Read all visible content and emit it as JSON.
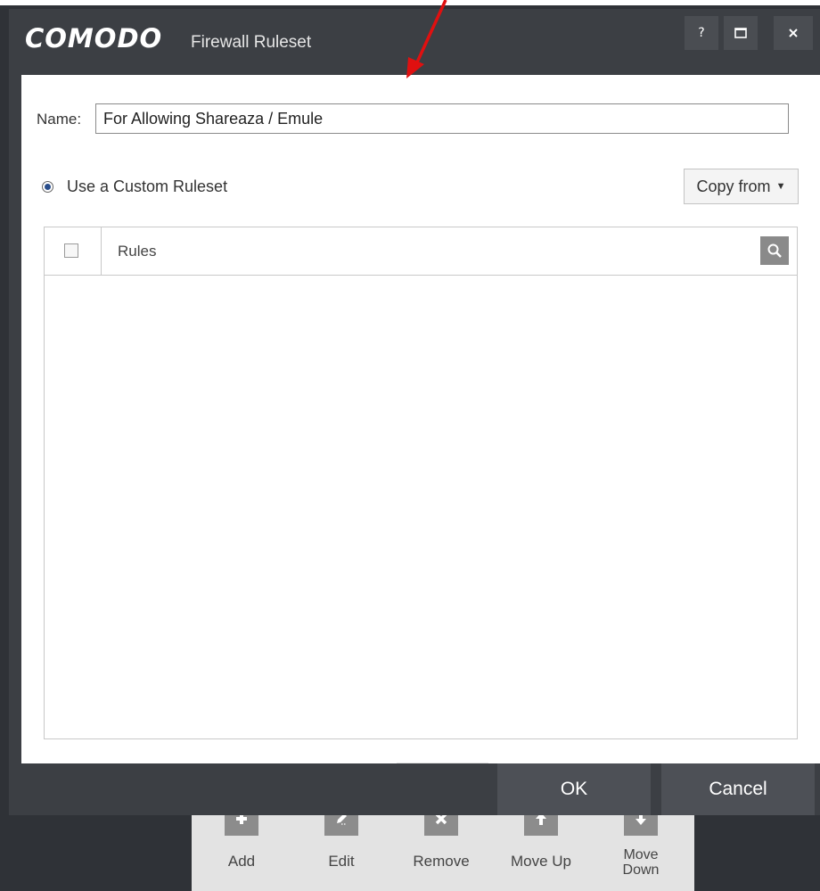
{
  "window": {
    "brand": "COMODO",
    "subtitle": "Firewall Ruleset",
    "help_label": "?",
    "maximize_label": "☐",
    "close_label": "✕"
  },
  "form": {
    "name_label": "Name:",
    "name_value": "For Allowing Shareaza / Emule",
    "radio_label": "Use a Custom Ruleset",
    "radio_checked": true,
    "copy_from_label": "Copy from"
  },
  "table": {
    "header_label": "Rules",
    "rows": []
  },
  "toolbar": {
    "add": "Add",
    "edit": "Edit",
    "remove": "Remove",
    "move_up": "Move Up",
    "move_down_line1": "Move",
    "move_down_line2": "Down"
  },
  "footer": {
    "ok": "OK",
    "cancel": "Cancel"
  },
  "colors": {
    "frame": "#3c3f44",
    "button": "#4d5056",
    "icon_tile": "#8c8c8c",
    "annotation_arrow": "#e01010"
  }
}
